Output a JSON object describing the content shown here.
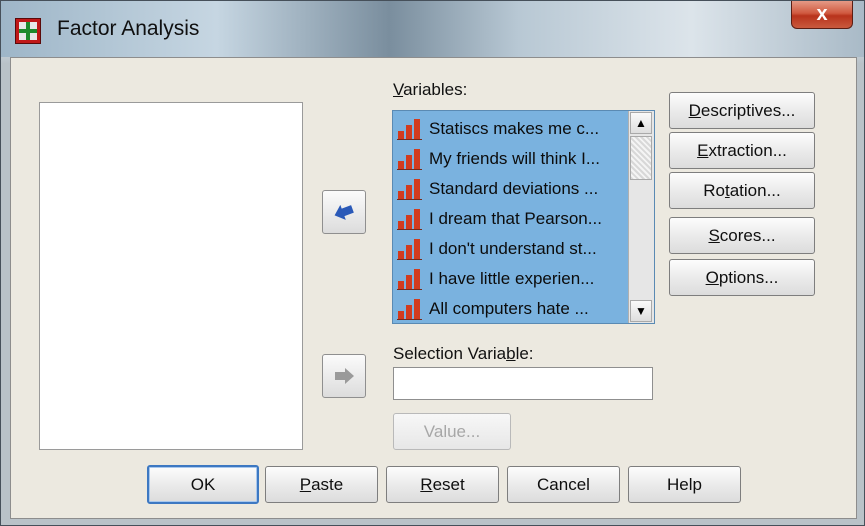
{
  "window": {
    "title": "Factor Analysis",
    "close_glyph": "x"
  },
  "labels": {
    "variables": [
      "V",
      "ariables:"
    ],
    "selection_variable": [
      "Selection Varia",
      "b",
      "le:"
    ]
  },
  "variables": [
    "Statiscs makes me c...",
    "My friends will think I...",
    "Standard deviations ...",
    "I dream that Pearson...",
    "I don't understand st...",
    "I have little experien...",
    "All computers hate ..."
  ],
  "side_buttons": {
    "descriptives": [
      "D",
      "escriptives..."
    ],
    "extraction": [
      "E",
      "xtraction..."
    ],
    "rotation": [
      "Ro",
      "t",
      "ation..."
    ],
    "scores": [
      "S",
      "cores..."
    ],
    "options": [
      "O",
      "ptions..."
    ]
  },
  "value_button": "Value...",
  "bottom_buttons": {
    "ok": "OK",
    "paste": [
      "P",
      "aste"
    ],
    "reset": [
      "R",
      "eset"
    ],
    "cancel": "Cancel",
    "help": "Help"
  },
  "icons": {
    "app": "spss-factor-icon",
    "move_to_variables": "arrow-left-icon",
    "move_to_selection": "arrow-right-icon",
    "variable_type": "scale-variable-icon"
  },
  "colors": {
    "selection": "#7ab2df",
    "arrow_active": "#2a59b8",
    "arrow_disabled": "#9a9a9a",
    "close": "#c8432a"
  }
}
